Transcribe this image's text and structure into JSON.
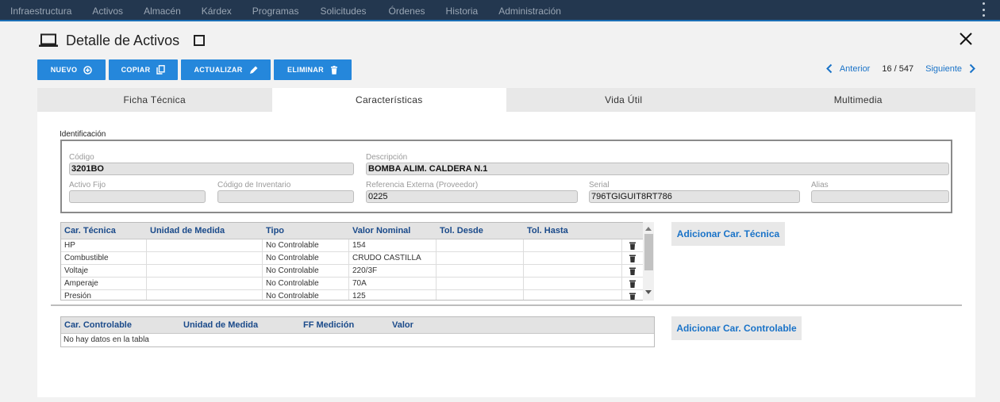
{
  "menu": [
    "Infraestructura",
    "Activos",
    "Almacén",
    "Kárdex",
    "Programas",
    "Solicitudes",
    "Órdenes",
    "Historia",
    "Administración"
  ],
  "page": {
    "title": "Detalle de Activos"
  },
  "toolbar": {
    "nuevo": "NUEVO",
    "copiar": "COPIAR",
    "actualizar": "ACTUALIZAR",
    "eliminar": "ELIMINAR"
  },
  "pager": {
    "prev": "Anterior",
    "count": "16 / 547",
    "next": "Siguiente"
  },
  "tabs": [
    "Ficha Técnica",
    "Características",
    "Vida Útil",
    "Multimedia"
  ],
  "active_tab": "Características",
  "identificacion": {
    "section_label": "Identificación",
    "codigo": {
      "label": "Código",
      "value": "3201BO"
    },
    "descripcion": {
      "label": "Descripción",
      "value": "BOMBA ALIM. CALDERA N.1"
    },
    "activo_fijo": {
      "label": "Activo Fijo",
      "value": ""
    },
    "codigo_inventario": {
      "label": "Código de Inventario",
      "value": ""
    },
    "referencia_externa": {
      "label": "Referencia Externa (Proveedor)",
      "value": "0225"
    },
    "serial": {
      "label": "Serial",
      "value": "796TGIGUIT8RT786"
    },
    "alias": {
      "label": "Alias",
      "value": ""
    }
  },
  "tecnica": {
    "headers": [
      "Car. Técnica",
      "Unidad de Medida",
      "Tipo",
      "Valor Nominal",
      "Tol. Desde",
      "Tol. Hasta"
    ],
    "rows": [
      [
        "HP",
        "",
        "No Controlable",
        "154",
        "",
        ""
      ],
      [
        "Combustible",
        "",
        "No Controlable",
        "CRUDO CASTILLA",
        "",
        ""
      ],
      [
        "Voltaje",
        "",
        "No Controlable",
        "220/3F",
        "",
        ""
      ],
      [
        "Amperaje",
        "",
        "No Controlable",
        "70A",
        "",
        ""
      ],
      [
        "Presión",
        "",
        "No Controlable",
        "125",
        "",
        ""
      ]
    ],
    "add_label": "Adicionar Car. Técnica"
  },
  "controlable": {
    "headers": [
      "Car. Controlable",
      "Unidad de Medida",
      "FF Medición",
      "Valor"
    ],
    "empty": "No hay datos en la tabla",
    "add_label": "Adicionar Car. Controlable"
  },
  "colors": {
    "topbar": "#23374f",
    "accent": "#2587db",
    "link": "#1a73c8"
  }
}
